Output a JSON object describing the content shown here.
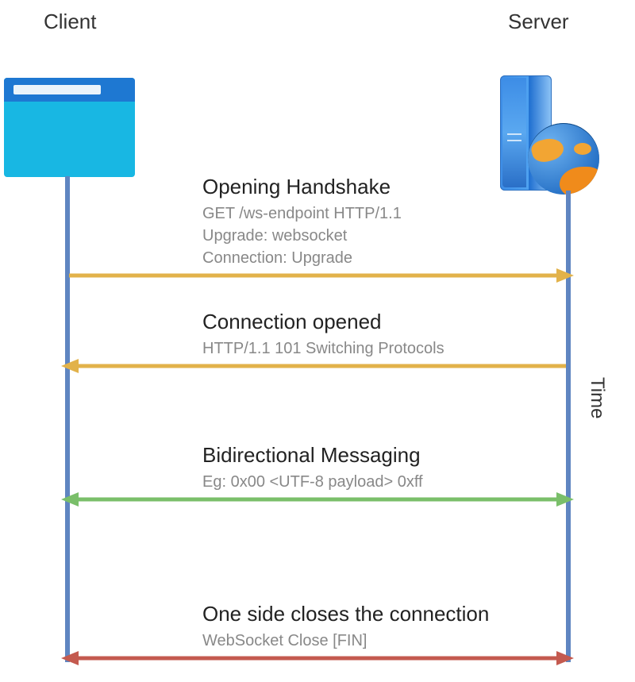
{
  "labels": {
    "client": "Client",
    "server": "Server",
    "time": "Time"
  },
  "steps": {
    "handshake": {
      "title": "Opening Handshake",
      "line1": "GET /ws-endpoint HTTP/1.1",
      "line2": "Upgrade: websocket",
      "line3": "Connection: Upgrade"
    },
    "opened": {
      "title": "Connection opened",
      "line1": "HTTP/1.1 101 Switching Protocols"
    },
    "bidir": {
      "title": "Bidirectional Messaging",
      "line1": "Eg: 0x00 <UTF-8 payload> 0xff"
    },
    "close": {
      "title": "One side closes the connection",
      "line1": "WebSocket Close [FIN]"
    }
  },
  "colors": {
    "arrow_yellow": "#e2b24a",
    "arrow_green": "#7abf6a",
    "arrow_red": "#c45a4f",
    "lifeline": "#5f85c1"
  }
}
